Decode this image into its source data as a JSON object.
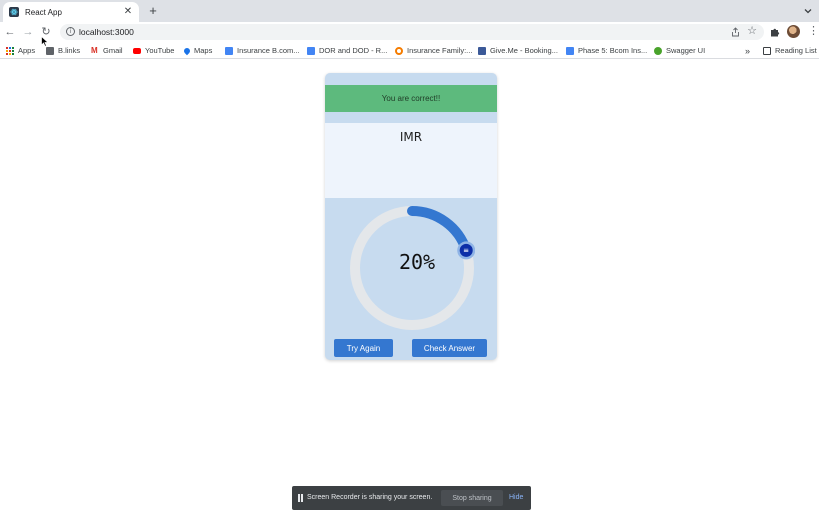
{
  "browser": {
    "tab_title": "React App",
    "tab_close": "✕",
    "new_tab": "+",
    "url": "localhost:3000",
    "back": "←",
    "forward": "→",
    "reload": "↻",
    "star": "☆",
    "kebab": "⋮"
  },
  "bookmarks": [
    {
      "label": "Apps",
      "icon": "apps-grid-icon"
    },
    {
      "label": "B.links",
      "icon": "folder-icon",
      "color": "#5f6368"
    },
    {
      "label": "Gmail",
      "icon": "gmail-icon",
      "color": "#d93025"
    },
    {
      "label": "YouTube",
      "icon": "youtube-icon",
      "color": "#ff0000"
    },
    {
      "label": "Maps",
      "icon": "maps-pin-icon",
      "color": "#1a73e8"
    },
    {
      "label": "Insurance B.com...",
      "icon": "docs-icon",
      "color": "#4285f4"
    },
    {
      "label": "DOR and DOD - R...",
      "icon": "docs-icon",
      "color": "#4285f4"
    },
    {
      "label": "Insurance Family:...",
      "icon": "orange-logo-icon",
      "color": "#f57c00"
    },
    {
      "label": "Give.Me - Booking...",
      "icon": "givemee-icon",
      "color": "#3b5998"
    },
    {
      "label": "Phase 5: Bcom Ins...",
      "icon": "docs-icon",
      "color": "#4285f4"
    },
    {
      "label": "Swagger UI",
      "icon": "swagger-icon",
      "color": "#49a32b"
    }
  ],
  "bookmarks_overflow": "»",
  "reading_list": "Reading List",
  "app": {
    "feedback": "You are correct!!",
    "word": "IMR",
    "progress_percent": 20,
    "progress_label": "20%",
    "knob_glyph": "≡",
    "try_again": "Try Again",
    "check_answer": "Check Answer"
  },
  "colors": {
    "card_bg": "#c7dbef",
    "feedback_bg": "#5dba7d",
    "progress_arc": "#3477d0",
    "track": "#e4e7ea",
    "knob": "#0d2fa8",
    "button": "#3477d0"
  },
  "share_bar": {
    "message": "Screen Recorder is sharing your screen.",
    "stop": "Stop sharing",
    "hide": "Hide"
  }
}
